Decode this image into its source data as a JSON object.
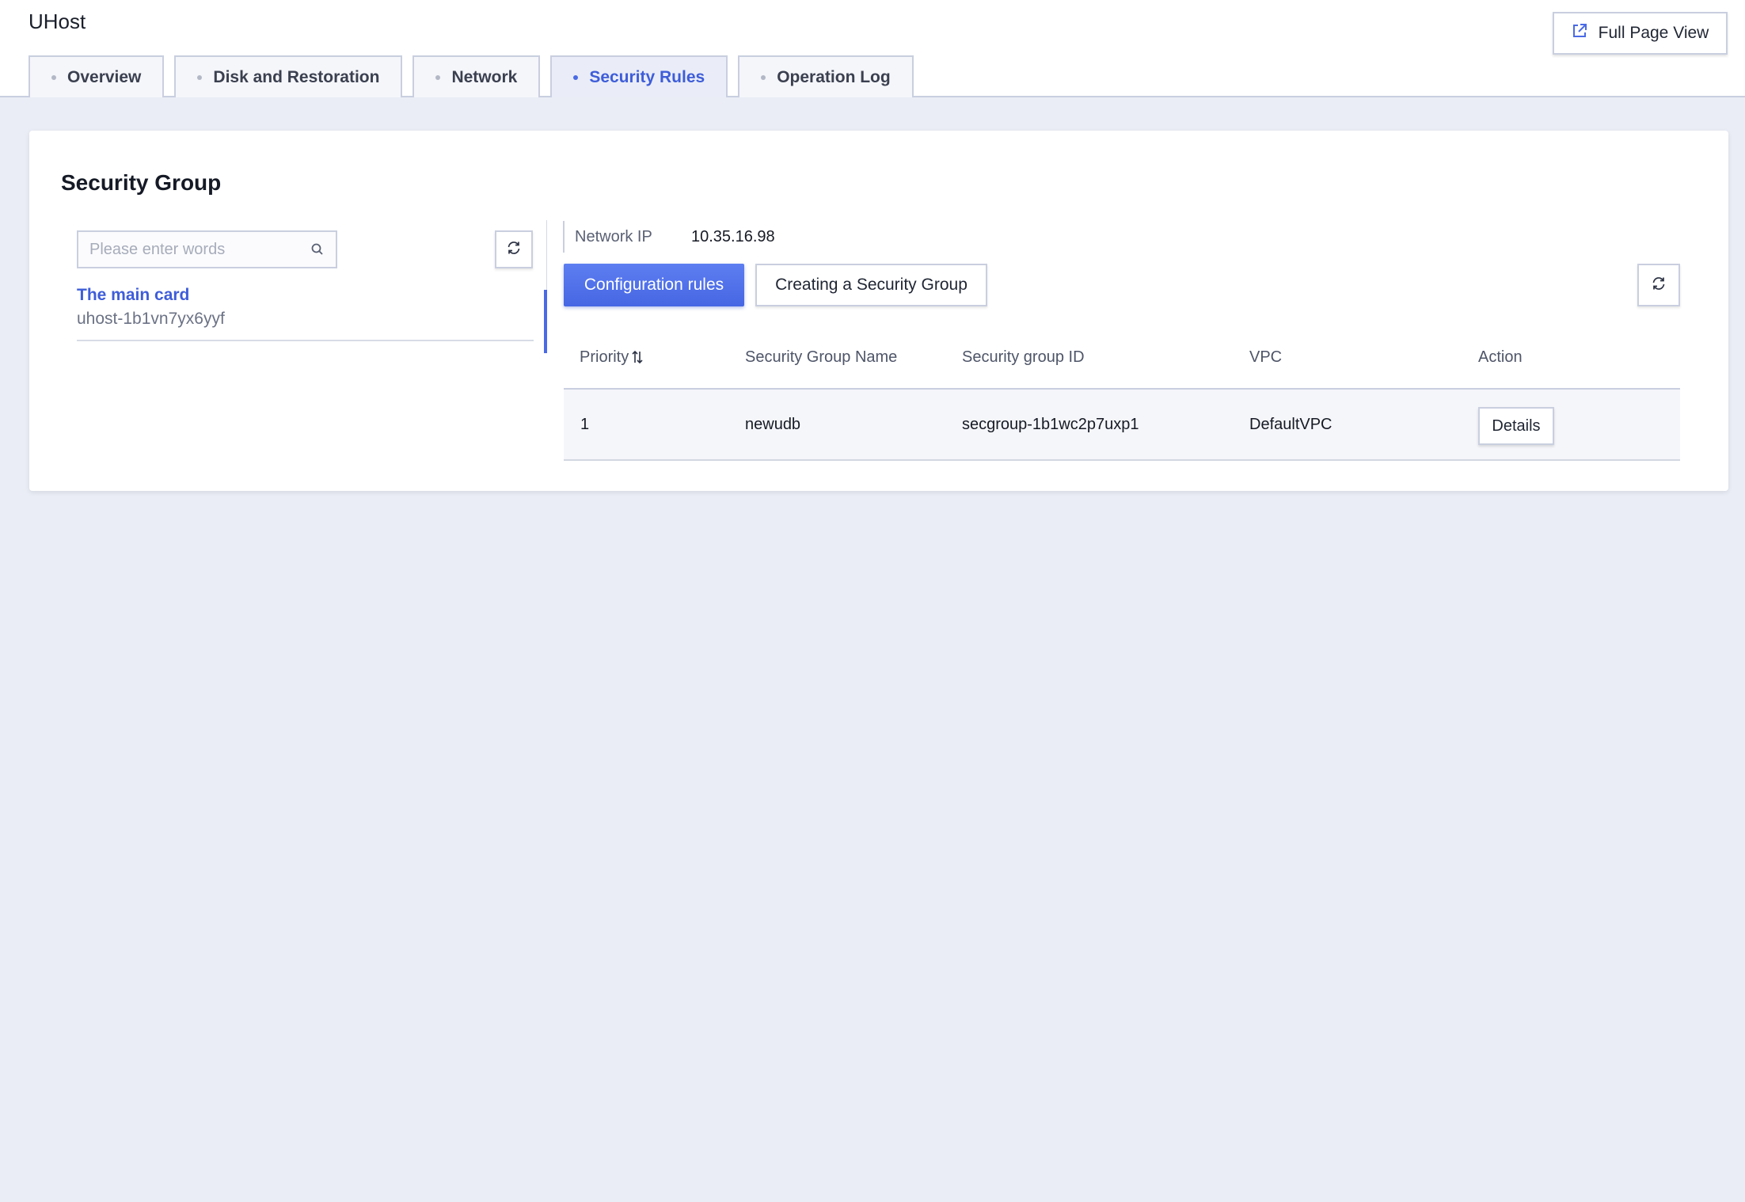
{
  "app": {
    "title": "UHost"
  },
  "header": {
    "full_page_label": "Full Page View"
  },
  "tabs": [
    {
      "label": "Overview",
      "active": false
    },
    {
      "label": "Disk and Restoration",
      "active": false
    },
    {
      "label": "Network",
      "active": false
    },
    {
      "label": "Security Rules",
      "active": true
    },
    {
      "label": "Operation Log",
      "active": false
    }
  ],
  "card": {
    "title": "Security Group"
  },
  "search": {
    "placeholder": "Please enter words",
    "value": ""
  },
  "host": {
    "name": "The main card",
    "id": "uhost-1b1vn7yx6yyf"
  },
  "network": {
    "label": "Network IP",
    "value": "10.35.16.98"
  },
  "actions": {
    "configure_label": "Configuration rules",
    "create_label": "Creating a Security Group"
  },
  "table": {
    "headers": {
      "priority": "Priority",
      "name": "Security Group Name",
      "id": "Security group ID",
      "vpc": "VPC",
      "action": "Action"
    },
    "rows": [
      {
        "priority": "1",
        "name": "newudb",
        "id": "secgroup-1b1wc2p7uxp1",
        "vpc": "DefaultVPC",
        "action": "Details"
      }
    ]
  },
  "icons": {
    "external_link": "external-link-icon",
    "search": "search-icon",
    "refresh": "refresh-icon",
    "sort": "sort-icon"
  },
  "colors": {
    "accent": "#4a6ae5",
    "background": "#eaedf5"
  }
}
